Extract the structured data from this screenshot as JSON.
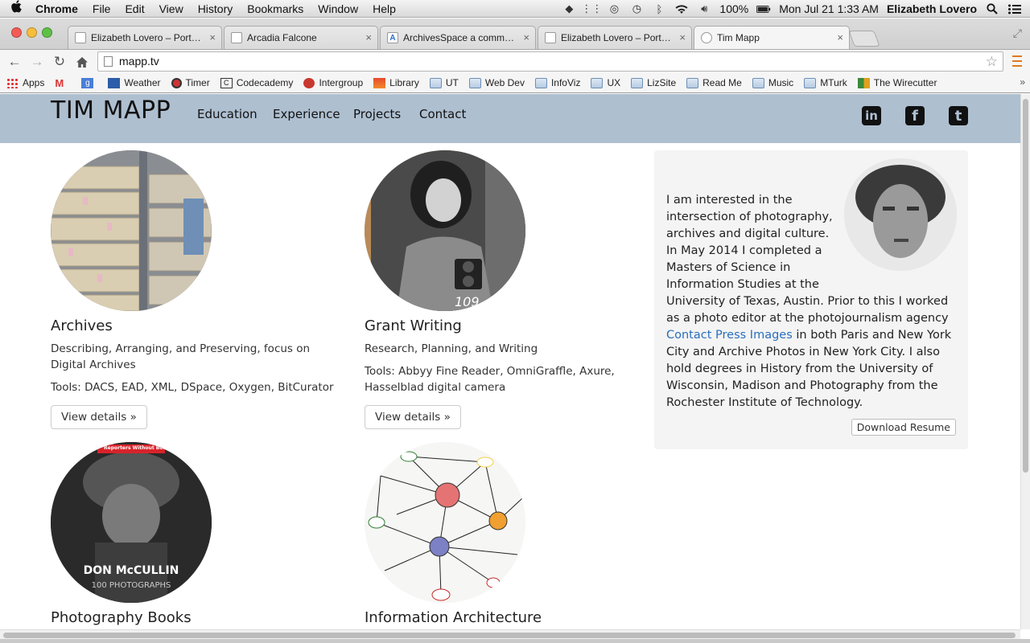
{
  "menubar": {
    "apple": "",
    "app_name": "Chrome",
    "menus": [
      "File",
      "Edit",
      "View",
      "History",
      "Bookmarks",
      "Window",
      "Help"
    ],
    "battery": "100%",
    "clock": "Mon Jul 21  1:33 AM",
    "user": "Elizabeth Lovero"
  },
  "tabs": [
    {
      "title": "Elizabeth Lovero – Portfolio",
      "active": false
    },
    {
      "title": "Arcadia Falcone",
      "active": false
    },
    {
      "title": "ArchivesSpace a community",
      "active": false
    },
    {
      "title": "Elizabeth Lovero – Portfolio",
      "active": false
    },
    {
      "title": "Tim Mapp",
      "active": true
    }
  ],
  "tab_close": "×",
  "toolbar": {
    "url": "mapp.tv",
    "star": "☆"
  },
  "bookmarks": [
    {
      "label": "Apps",
      "type": "apps"
    },
    {
      "label": "",
      "type": "gmail"
    },
    {
      "label": "",
      "type": "google"
    },
    {
      "label": "Weather",
      "type": "site"
    },
    {
      "label": "Timer",
      "type": "site"
    },
    {
      "label": "Codecademy",
      "type": "site"
    },
    {
      "label": "Intergroup",
      "type": "site"
    },
    {
      "label": "Library",
      "type": "site"
    },
    {
      "label": "UT",
      "type": "folder"
    },
    {
      "label": "Web Dev",
      "type": "folder"
    },
    {
      "label": "InfoViz",
      "type": "folder"
    },
    {
      "label": "UX",
      "type": "folder"
    },
    {
      "label": "LizSite",
      "type": "folder"
    },
    {
      "label": "Read Me",
      "type": "folder"
    },
    {
      "label": "Music",
      "type": "folder"
    },
    {
      "label": "MTurk",
      "type": "folder"
    },
    {
      "label": "The Wirecutter",
      "type": "site"
    }
  ],
  "bookmarks_more": "»",
  "site": {
    "brand": "TIM MAPP",
    "nav": [
      "Education",
      "Experience",
      "Projects",
      "Contact"
    ],
    "social": [
      "in",
      "f",
      "t"
    ],
    "cards": [
      {
        "title": "Archives",
        "desc": "Describing, Arranging, and Preserving, focus on Digital Archives",
        "tools": "Tools: DACS, EAD, XML, DSpace, Oxygen, BitCurator",
        "button": "View details »"
      },
      {
        "title": "Grant Writing",
        "desc": "Research, Planning, and Writing",
        "tools": "Tools: Abbyy Fine Reader, OmniGraffle, Axure, Hasselblad digital camera",
        "button": "View details »"
      },
      {
        "title": "Photography Books",
        "cover_title": "DON McCULLIN",
        "cover_sub": "100 PHOTOGRAPHS",
        "cover_tag": "Reporters Without Borders"
      },
      {
        "title": "Information Architecture"
      }
    ],
    "bio": {
      "text_before": "I am interested in the intersection of photography, archives and digital culture. In May 2014 I completed a Masters of Science in Information Studies at the University of Texas, Austin. Prior to this I worked as a photo editor at the photojournalism agency ",
      "link": "Contact Press Images",
      "text_after": " in both Paris and New York City and Archive Photos in New York City. I also hold degrees in History from the University of Wisconsin, Madison and Photography from the Rochester Institute of Technology.",
      "button": "Download Resume"
    }
  },
  "colors": {
    "nav_bg": "#aebfd0",
    "link": "#2a6ebb",
    "aside_bg": "#f4f4f4"
  }
}
